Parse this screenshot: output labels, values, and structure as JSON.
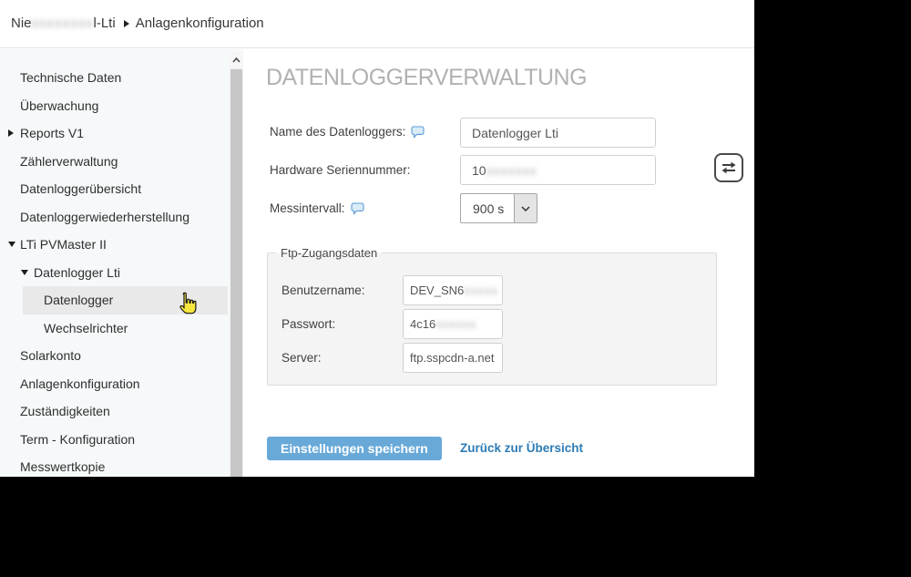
{
  "breadcrumb": {
    "site_prefix": "Nie",
    "site_masked": "xxxxxxxx",
    "site_suffix": "l-Lti",
    "page": "Anlagenkonfiguration"
  },
  "sidebar": {
    "items": [
      {
        "label": "Technische Daten",
        "level": 0,
        "arrow": "none",
        "selected": false
      },
      {
        "label": "Überwachung",
        "level": 0,
        "arrow": "none",
        "selected": false
      },
      {
        "label": "Reports V1",
        "level": 0,
        "arrow": "collapsed",
        "selected": false
      },
      {
        "label": "Zählerverwaltung",
        "level": 0,
        "arrow": "none",
        "selected": false
      },
      {
        "label": "Datenloggerübersicht",
        "level": 0,
        "arrow": "none",
        "selected": false
      },
      {
        "label": "Datenloggerwiederherstellung",
        "level": 0,
        "arrow": "none",
        "selected": false
      },
      {
        "label": "LTi PVMaster II",
        "level": 0,
        "arrow": "expanded",
        "selected": false
      },
      {
        "label": "Datenlogger Lti",
        "level": 1,
        "arrow": "expanded",
        "selected": false
      },
      {
        "label": "Datenlogger",
        "level": 2,
        "arrow": "none",
        "selected": true
      },
      {
        "label": "Wechselrichter",
        "level": 2,
        "arrow": "none",
        "selected": false
      },
      {
        "label": "Solarkonto",
        "level": 0,
        "arrow": "none",
        "selected": false
      },
      {
        "label": "Anlagenkonfiguration",
        "level": 0,
        "arrow": "none",
        "selected": false
      },
      {
        "label": "Zuständigkeiten",
        "level": 0,
        "arrow": "none",
        "selected": false
      },
      {
        "label": "Term - Konfiguration",
        "level": 0,
        "arrow": "none",
        "selected": false
      },
      {
        "label": "Messwertkopie",
        "level": 0,
        "arrow": "none",
        "selected": false
      }
    ]
  },
  "main": {
    "title": "DATENLOGGERVERWALTUNG",
    "fields": {
      "name": {
        "label": "Name des Datenloggers:",
        "value": "Datenlogger Lti"
      },
      "serial": {
        "label": "Hardware Seriennummer:",
        "value_visible": "10",
        "value_masked": "xxxxxxx"
      },
      "interval": {
        "label": "Messintervall:",
        "value": "900 s"
      }
    },
    "ftp": {
      "legend": "Ftp-Zugangsdaten",
      "username": {
        "label": "Benutzername:",
        "value_visible": "DEV_SN6",
        "value_masked": "xxxxx"
      },
      "password": {
        "label": "Passwort:",
        "value_visible": "4c16",
        "value_masked": "xxxxxx"
      },
      "server": {
        "label": "Server:",
        "value": "ftp.sspcdn-a.net"
      }
    },
    "actions": {
      "save": "Einstellungen speichern",
      "back": "Zurück zur Übersicht"
    }
  },
  "colors": {
    "accent_button": "#68a9d8",
    "link": "#2d7cb5",
    "title_gray": "#b1b1b1",
    "sidebar_bg": "#f6f9fa",
    "selected_row": "#e9e9e9",
    "fieldset_bg": "#f4f4f4"
  }
}
